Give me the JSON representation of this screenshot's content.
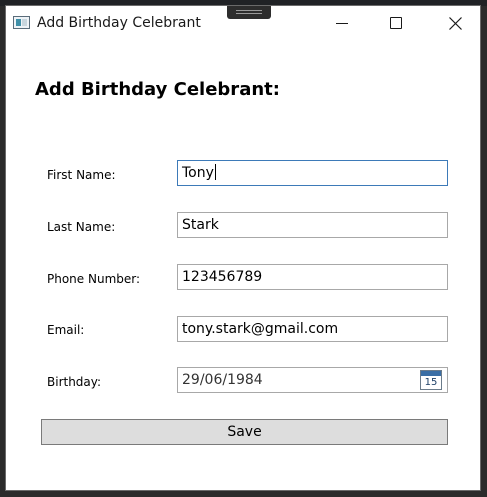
{
  "window": {
    "title": "Add Birthday Celebrant"
  },
  "form": {
    "heading": "Add Birthday Celebrant:",
    "first_name": {
      "label": "First Name:",
      "value": "Tony"
    },
    "last_name": {
      "label": "Last Name:",
      "value": "Stark"
    },
    "phone": {
      "label": "Phone Number:",
      "value": "123456789"
    },
    "email": {
      "label": "Email:",
      "value": "tony.stark@gmail.com"
    },
    "birthday": {
      "label": "Birthday:",
      "value": "29/06/1984",
      "calendar_day": "15"
    },
    "save_label": "Save"
  },
  "icons": {
    "app": "app-window-icon",
    "minimize": "minimize-icon",
    "maximize": "maximize-icon",
    "close": "close-icon",
    "calendar": "calendar-icon"
  },
  "colors": {
    "focus_border": "#3d7ab8",
    "button_bg": "#dddddd",
    "field_border": "#a8a8a8"
  }
}
